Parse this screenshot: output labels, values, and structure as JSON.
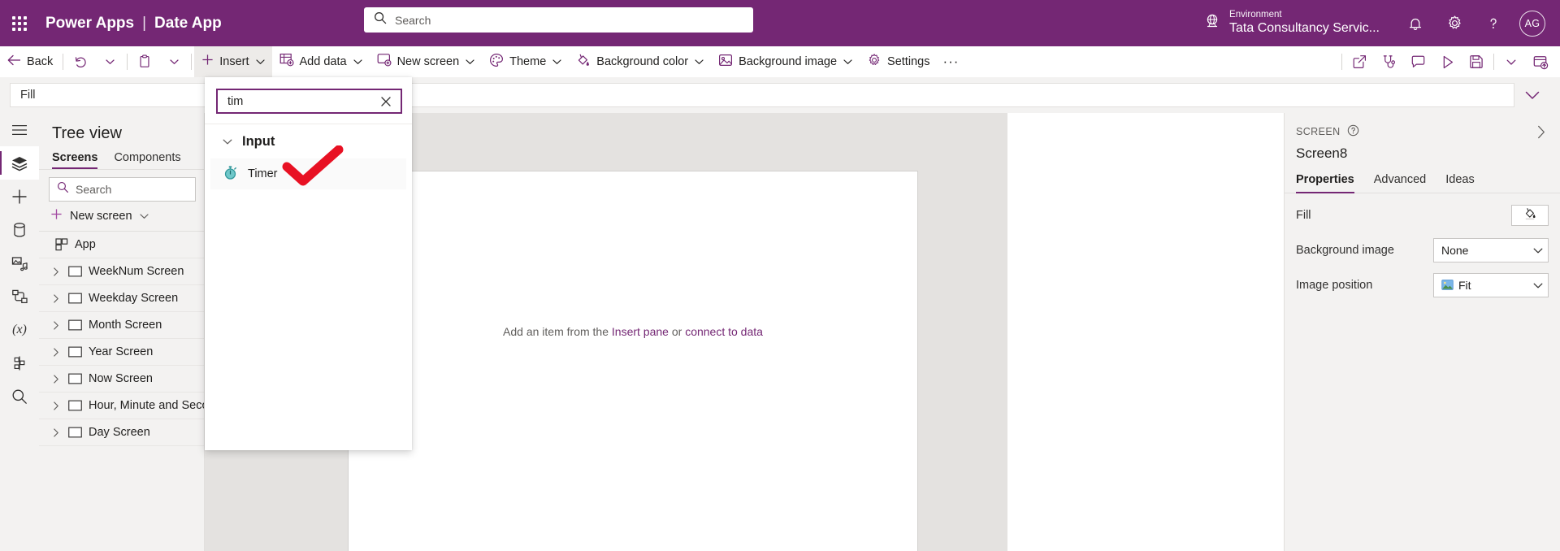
{
  "header": {
    "waffle_icon": "app-launcher-icon",
    "product": "Power Apps",
    "separator": "|",
    "app_name": "Date App",
    "search_placeholder": "Search",
    "search_value": "",
    "environment_label": "Environment",
    "environment_value": "Tata Consultancy Servic...",
    "notifications_icon": "bell-icon",
    "settings_icon": "gear-icon",
    "help_icon": "question-mark-icon",
    "avatar_initials": "AG"
  },
  "commandbar": {
    "back": "Back",
    "undo_icon": "undo-icon",
    "redo_chevron_icon": "chevron-down-icon",
    "paste_icon": "clipboard-icon",
    "paste_chevron_icon": "chevron-down-icon",
    "insert": "Insert",
    "add_data": "Add data",
    "new_screen": "New screen",
    "theme": "Theme",
    "background_color": "Background color",
    "background_image": "Background image",
    "settings": "Settings",
    "overflow": "···",
    "right_icons": [
      {
        "name": "share-icon"
      },
      {
        "name": "app-checker-icon"
      },
      {
        "name": "comments-icon"
      },
      {
        "name": "preview-play-icon"
      },
      {
        "name": "save-icon"
      },
      {
        "name": "save-chevron-icon"
      },
      {
        "name": "publish-icon"
      }
    ]
  },
  "formulabar": {
    "property": "Fill",
    "expand_icon": "chevron-down-icon"
  },
  "rail": {
    "items": [
      {
        "name": "hamburger-menu-icon"
      },
      {
        "name": "tree-view-layers-icon"
      },
      {
        "name": "insert-plus-icon"
      },
      {
        "name": "data-cylinder-icon"
      },
      {
        "name": "media-icon"
      },
      {
        "name": "power-automate-icon"
      },
      {
        "name": "variables-fx-icon"
      },
      {
        "name": "components-icon"
      },
      {
        "name": "search-icon"
      }
    ]
  },
  "treeview": {
    "title": "Tree view",
    "tabs": [
      {
        "label": "Screens",
        "active": true
      },
      {
        "label": "Components",
        "active": false
      }
    ],
    "search_placeholder": "Search",
    "search_value": "",
    "new_screen": "New screen",
    "app_item": "App",
    "screens": [
      "WeekNum Screen",
      "Weekday Screen",
      "Month Screen",
      "Year Screen",
      "Now Screen",
      "Hour, Minute and Second",
      "Day Screen"
    ]
  },
  "insert_flyout": {
    "search_value": "tim",
    "clear_icon": "close-x-icon",
    "group_label": "Input",
    "group_chevron_icon": "chevron-down-icon",
    "items": [
      {
        "label": "Timer",
        "icon": "stopwatch-timer-icon",
        "icon_color": "#31989b"
      }
    ],
    "annotation": "red-check-mark"
  },
  "canvas": {
    "hint_prefix": "Add an item from the ",
    "hint_link1": "Insert pane",
    "hint_middle": " or ",
    "hint_link2": "connect to data"
  },
  "properties": {
    "kicker": "SCREEN",
    "help_icon": "question-circle-icon",
    "collapse_icon": "chevron-right-icon",
    "selected_name": "Screen8",
    "tabs": [
      {
        "label": "Properties",
        "active": true
      },
      {
        "label": "Advanced",
        "active": false
      },
      {
        "label": "Ideas",
        "active": false
      }
    ],
    "rows": [
      {
        "label": "Fill",
        "type": "color",
        "icon": "paint-bucket-icon"
      },
      {
        "label": "Background image",
        "type": "select",
        "value": "None"
      },
      {
        "label": "Image position",
        "type": "select",
        "value": "Fit",
        "icon": "image-icon"
      }
    ]
  },
  "colors": {
    "brand_purple": "#742774",
    "canvas_gray": "#e4e2e0",
    "panel_gray": "#f3f2f1",
    "annotation_red": "#e81123",
    "timer_teal": "#31989b"
  }
}
